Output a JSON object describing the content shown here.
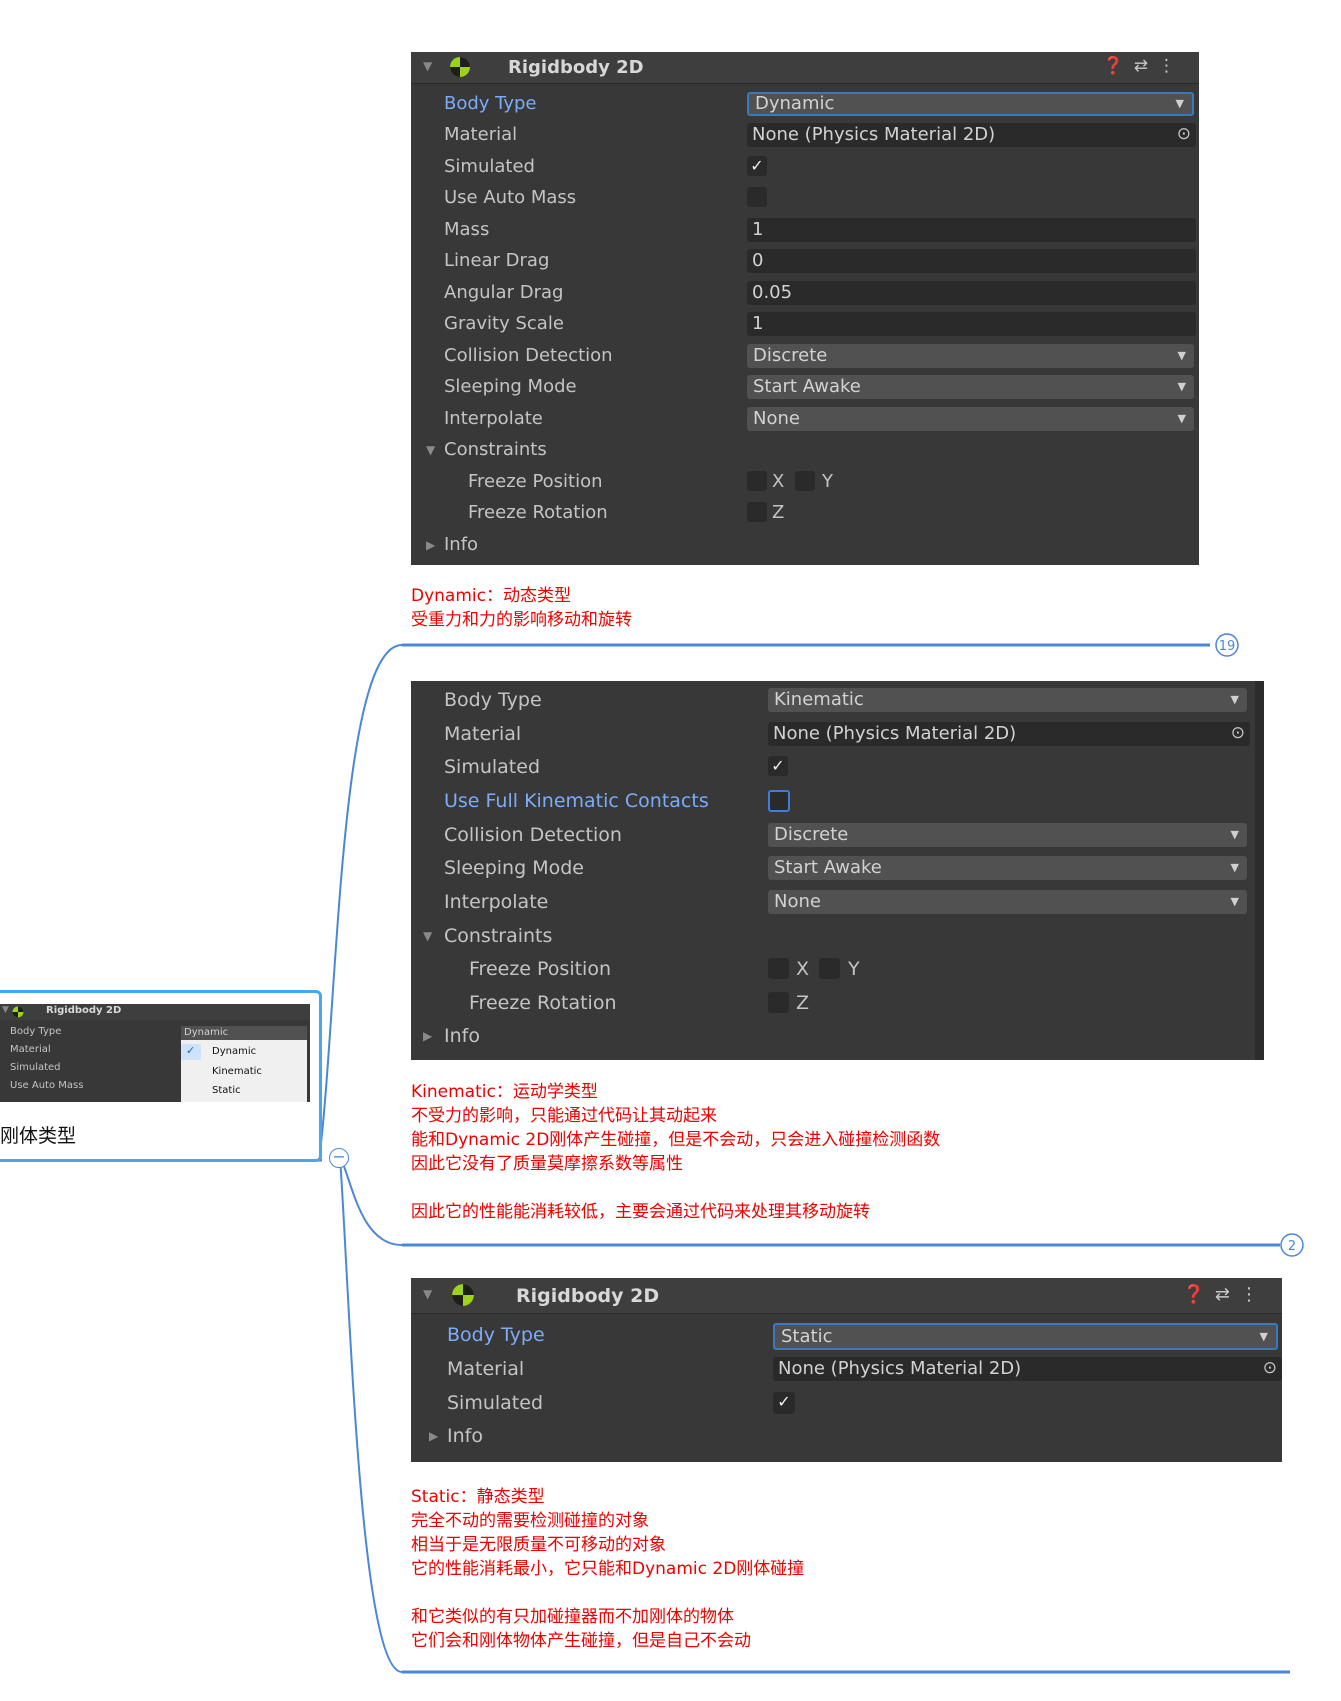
{
  "panel1": {
    "title": "Rigidbody 2D",
    "rows": {
      "body_type": {
        "label": "Body Type",
        "value": "Dynamic"
      },
      "material": {
        "label": "Material",
        "value": "None (Physics Material 2D)"
      },
      "simulated": {
        "label": "Simulated",
        "check": "✓"
      },
      "use_auto_mass": {
        "label": "Use Auto Mass"
      },
      "mass": {
        "label": "Mass",
        "value": "1"
      },
      "linear_drag": {
        "label": "Linear Drag",
        "value": "0"
      },
      "angular_drag": {
        "label": "Angular Drag",
        "value": "0.05"
      },
      "gravity_scale": {
        "label": "Gravity Scale",
        "value": "1"
      },
      "collision_detection": {
        "label": "Collision Detection",
        "value": "Discrete"
      },
      "sleeping_mode": {
        "label": "Sleeping Mode",
        "value": "Start Awake"
      },
      "interpolate": {
        "label": "Interpolate",
        "value": "None"
      },
      "constraints": {
        "label": "Constraints"
      },
      "freeze_position": {
        "label": "Freeze Position",
        "x": "X",
        "y": "Y"
      },
      "freeze_rotation": {
        "label": "Freeze Rotation",
        "z": "Z"
      },
      "info": {
        "label": "Info"
      }
    }
  },
  "note1": "Dynamic：动态类型\n受重力和力的影响移动和旋转",
  "badge1": "19",
  "panel2": {
    "rows": {
      "body_type": {
        "label": "Body Type",
        "value": "Kinematic"
      },
      "material": {
        "label": "Material",
        "value": "None (Physics Material 2D)"
      },
      "simulated": {
        "label": "Simulated",
        "check": "✓"
      },
      "use_full_kinematic": {
        "label": "Use Full Kinematic Contacts"
      },
      "collision_detection": {
        "label": "Collision Detection",
        "value": "Discrete"
      },
      "sleeping_mode": {
        "label": "Sleeping Mode",
        "value": "Start Awake"
      },
      "interpolate": {
        "label": "Interpolate",
        "value": "None"
      },
      "constraints": {
        "label": "Constraints"
      },
      "freeze_position": {
        "label": "Freeze Position",
        "x": "X",
        "y": "Y"
      },
      "freeze_rotation": {
        "label": "Freeze Rotation",
        "z": "Z"
      },
      "info": {
        "label": "Info"
      }
    }
  },
  "note2": "Kinematic：运动学类型\n不受力的影响，只能通过代码让其动起来\n能和Dynamic 2D刚体产生碰撞，但是不会动，只会进入碰撞检测函数\n因此它没有了质量莫摩擦系数等属性\n\n因此它的性能能消耗较低，主要会通过代码来处理其移动旋转",
  "badge2": "2",
  "panel3": {
    "title": "Rigidbody 2D",
    "rows": {
      "body_type": {
        "label": "Body Type",
        "value": "Static"
      },
      "material": {
        "label": "Material",
        "value": "None (Physics Material 2D)"
      },
      "simulated": {
        "label": "Simulated",
        "check": "✓"
      },
      "info": {
        "label": "Info"
      }
    }
  },
  "note3": "Static：静态类型\n完全不动的需要检测碰撞的对象\n相当于是无限质量不可移动的对象\n它的性能消耗最小，它只能和Dynamic 2D刚体碰撞\n\n和它类似的有只加碰撞器而不加刚体的物体\n它们会和刚体物体产生碰撞，但是自己不会动",
  "left_node": {
    "mini": {
      "title": "Rigidbody 2D",
      "labels": [
        "Body Type",
        "Material",
        "Simulated",
        "Use Auto Mass"
      ],
      "dropdown": "Dynamic",
      "options": [
        "Dynamic",
        "Kinematic",
        "Static"
      ],
      "check": "✓"
    },
    "text": "刚体类型",
    "collapse": "−"
  },
  "colors": {
    "connector": "#4a87d9",
    "note": "#ee0000",
    "panel": "#383838",
    "accent": "#7cacf8"
  },
  "icons": [
    "fold-triangle-icon",
    "rigidbody-icon",
    "help-icon",
    "preset-icon",
    "more-icon",
    "target-icon",
    "checkmark-icon",
    "collapse-icon"
  ]
}
